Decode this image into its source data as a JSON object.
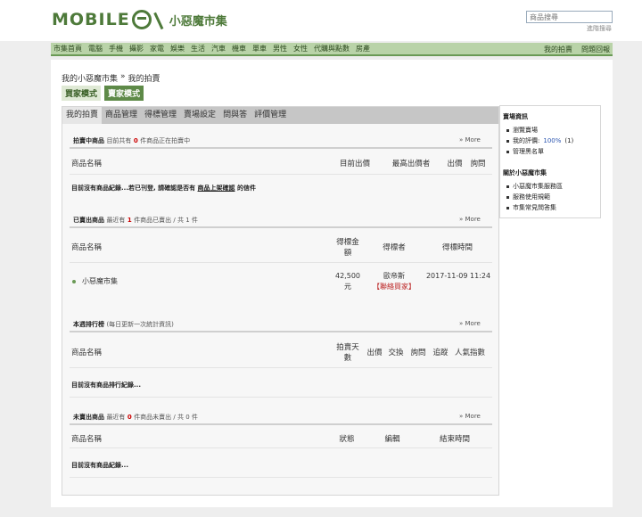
{
  "header": {
    "logo_text": "MOBILE",
    "logo_sub": "小惡魔市集",
    "search_placeholder": "商品搜尋",
    "advanced_search": "進階搜尋"
  },
  "nav": {
    "items": [
      "市集首頁",
      "電腦",
      "手機",
      "攝影",
      "家電",
      "娛樂",
      "生活",
      "汽車",
      "機車",
      "單車",
      "男性",
      "女性",
      "代購與點數",
      "房產"
    ],
    "right": [
      "我的拍賣",
      "問題回報"
    ]
  },
  "breadcrumb": {
    "root": "我的小惡魔市集",
    "sep": "»",
    "current": "我的拍賣"
  },
  "modes": {
    "buyer": "買家模式",
    "seller": "賣家模式"
  },
  "tabs": [
    "我的拍賣",
    "商品管理",
    "得標管理",
    "賣場設定",
    "問與答",
    "評價管理"
  ],
  "sections": {
    "auction": {
      "title": "拍賣中商品",
      "desc_pre": "目前共有",
      "count": "0",
      "desc_post": "件商品正在拍賣中",
      "more": "» More",
      "headers": [
        "商品名稱",
        "目前出價",
        "最高出價者",
        "出價",
        "詢問"
      ],
      "empty_pre": "目前沒有商品紀錄...若已刊登, 請確認是否有",
      "empty_link": "商品上架確認",
      "empty_post": "的信件"
    },
    "sold": {
      "title": "已賣出商品",
      "desc_pre": "最近有",
      "count": "1",
      "desc_post": "件商品已賣出 / 共 1 件",
      "more": "» More",
      "headers": [
        "商品名稱",
        "得標金額",
        "得標者",
        "得標時間"
      ],
      "row": {
        "name": "小惡魔市集",
        "price": "42,500元",
        "winner": "歐帝斯",
        "contact": "【聯絡買家】",
        "time": "2017-11-09 11:24"
      }
    },
    "ranking": {
      "title": "本週排行榜",
      "desc": "(每日更新一次統計資訊)",
      "more": "» More",
      "headers": [
        "商品名稱",
        "拍賣天數",
        "出價",
        "交換",
        "詢問",
        "追蹤",
        "人氣指數"
      ],
      "empty": "目前沒有商品排行紀錄..."
    },
    "unsold": {
      "title": "未賣出商品",
      "desc_pre": "最近有",
      "count": "0",
      "desc_post": "件商品未賣出 / 共 0 件",
      "more": "» More",
      "headers": [
        "商品名稱",
        "狀態",
        "編輯",
        "結束時間"
      ],
      "empty": "目前沒有商品紀錄..."
    }
  },
  "sidebar": {
    "info_title": "賣場資訊",
    "items": [
      "瀏覽賣場",
      "管理黑名單"
    ],
    "rating_label": "我的評價:",
    "rating_pct": "100%",
    "rating_count": "(1)",
    "about_title": "關於小惡魔市集",
    "about_items": [
      "小惡魔市集服務區",
      "服務使用規範",
      "市集常見問答集"
    ]
  }
}
